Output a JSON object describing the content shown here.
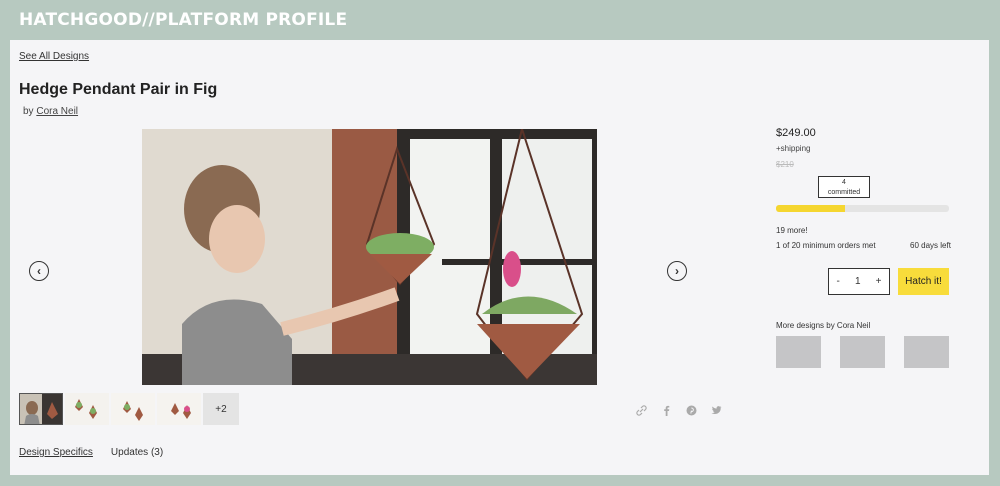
{
  "banner": {
    "title": "HATCHGOOD//PLATFORM PROFILE"
  },
  "nav": {
    "see_all": "See All Designs"
  },
  "product": {
    "title": "Hedge Pendant Pair in Fig",
    "by_prefix": "by",
    "author": "Cora Neil"
  },
  "gallery": {
    "prev_icon": "chevron-left-icon",
    "next_icon": "chevron-right-icon",
    "more_label": "+2"
  },
  "share_icons": [
    "link-icon",
    "facebook-icon",
    "pinterest-icon",
    "twitter-icon"
  ],
  "tabs": [
    {
      "label": "Design Specifics"
    },
    {
      "label": "Updates (3)"
    }
  ],
  "purchase": {
    "price": "$249.00",
    "shipping": "+shipping",
    "retail": "$210",
    "committed_count": "4",
    "committed_label": "committed",
    "progress_fraction": 0.4,
    "more_needed": "19 more!",
    "orders_met": "1 of 20 minimum orders met",
    "days_left": "60 days left",
    "minus": "-",
    "quantity": "1",
    "plus": "+",
    "hatch_label": "Hatch it!",
    "more_designs": "More designs by Cora Neil"
  },
  "colors": {
    "background": "#b7c9c0",
    "accent": "#f8dc3b",
    "progress_fill": "#f5d630"
  }
}
